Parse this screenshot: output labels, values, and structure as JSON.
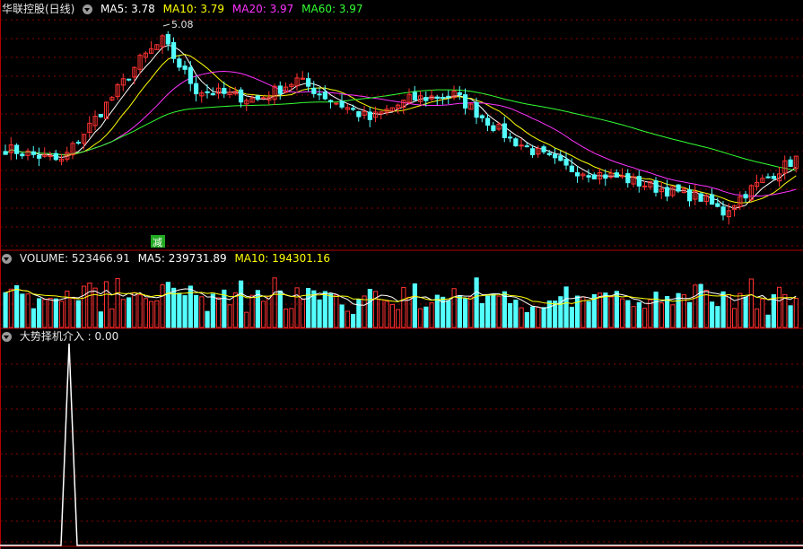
{
  "price_panel": {
    "title": "华联控股(日线)",
    "ma5": "MA5: 3.78",
    "ma10": "MA10: 3.79",
    "ma20": "MA20: 3.97",
    "ma60": "MA60: 3.97",
    "high_label": "5.08",
    "marker_label": "减"
  },
  "volume_panel": {
    "label": "VOLUME: 523466.91",
    "ma5": "MA5: 239731.89",
    "ma10": "MA10: 194301.16"
  },
  "indicator_panel": {
    "label": "大势择机介入 : 0.00"
  },
  "colors": {
    "background": "#000000",
    "up": "#ff3232",
    "down": "#54ffff",
    "ma5": "#ffffff",
    "ma10": "#ffff00",
    "ma20": "#ff33ff",
    "ma60": "#33ff33",
    "panel_border": "#b40000",
    "gridline": "#8b0000",
    "marker": "#22aa22"
  },
  "icons": [
    "dropdown-circle-icon"
  ]
}
